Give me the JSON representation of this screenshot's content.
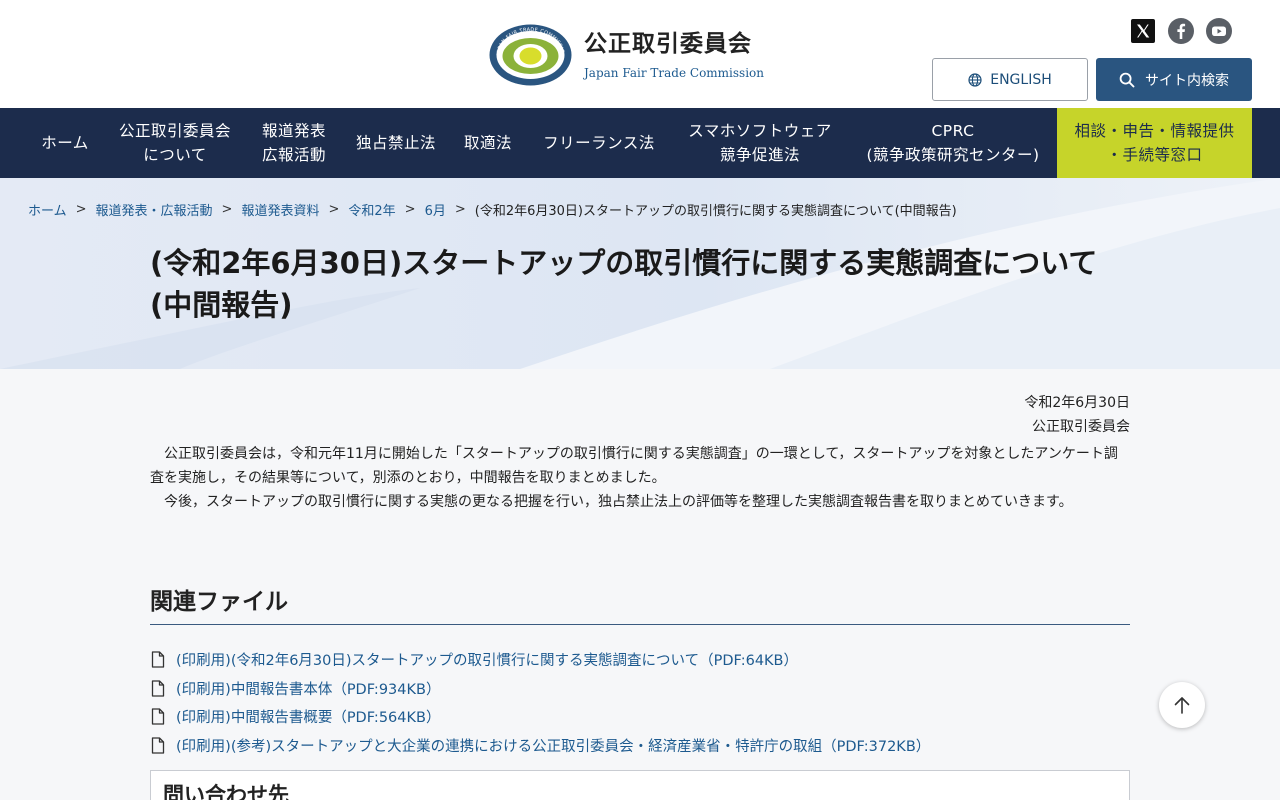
{
  "header": {
    "logo_name_jp": "公正取引委員会",
    "logo_name_en": "Japan Fair Trade Commission",
    "emblem_text": "JAPAN FAIR TRADE COMMISSION",
    "english_label": "ENGLISH",
    "search_label": "サイト内検索",
    "social": [
      "x-icon",
      "facebook-icon",
      "youtube-icon"
    ]
  },
  "nav": {
    "items": [
      {
        "line1": "ホーム",
        "line2": ""
      },
      {
        "line1": "公正取引委員会",
        "line2": "について"
      },
      {
        "line1": "報道発表",
        "line2": "広報活動"
      },
      {
        "line1": "独占禁止法",
        "line2": ""
      },
      {
        "line1": "取適法",
        "line2": ""
      },
      {
        "line1": "フリーランス法",
        "line2": ""
      },
      {
        "line1": "スマホソフトウェア",
        "line2": "競争促進法"
      },
      {
        "line1": "CPRC",
        "line2": "(競争政策研究センター)"
      },
      {
        "line1": "相談・申告・情報提供",
        "line2": "・手続等窓口"
      }
    ]
  },
  "breadcrumb": {
    "items": [
      "ホーム",
      "報道発表・広報活動",
      "報道発表資料",
      "令和2年",
      "6月"
    ],
    "separator": ">",
    "current": "(令和2年6月30日)スタートアップの取引慣行に関する実態調査について(中間報告)"
  },
  "page": {
    "title": "(令和2年6月30日)スタートアップの取引慣行に関する実態調査について(中間報告)",
    "date": "令和2年6月30日",
    "org": "公正取引委員会",
    "paragraphs": [
      "公正取引委員会は，令和元年11月に開始した「スタートアップの取引慣行に関する実態調査」の一環として，スタートアップを対象としたアンケート調査を実施し，その結果等について，別添のとおり，中間報告を取りまとめました。",
      "今後，スタートアップの取引慣行に関する実態の更なる把握を行い，独占禁止法上の評価等を整理した実態調査報告書を取りまとめていきます。"
    ]
  },
  "related_files": {
    "title": "関連ファイル",
    "files": [
      "(印刷用)(令和2年6月30日)スタートアップの取引慣行に関する実態調査について（PDF:64KB）",
      "(印刷用)中間報告書本体（PDF:934KB）",
      "(印刷用)中間報告書概要（PDF:564KB）",
      "(印刷用)(参考)スタートアップと大企業の連携における公正取引委員会・経済産業省・特許庁の取組（PDF:372KB）"
    ]
  },
  "contact": {
    "title": "問い合わせ先"
  },
  "colors": {
    "nav_bg": "#1c2c4c",
    "accent_green": "#c6d42a",
    "link": "#1d5a8f",
    "search_button": "#2a5580"
  }
}
